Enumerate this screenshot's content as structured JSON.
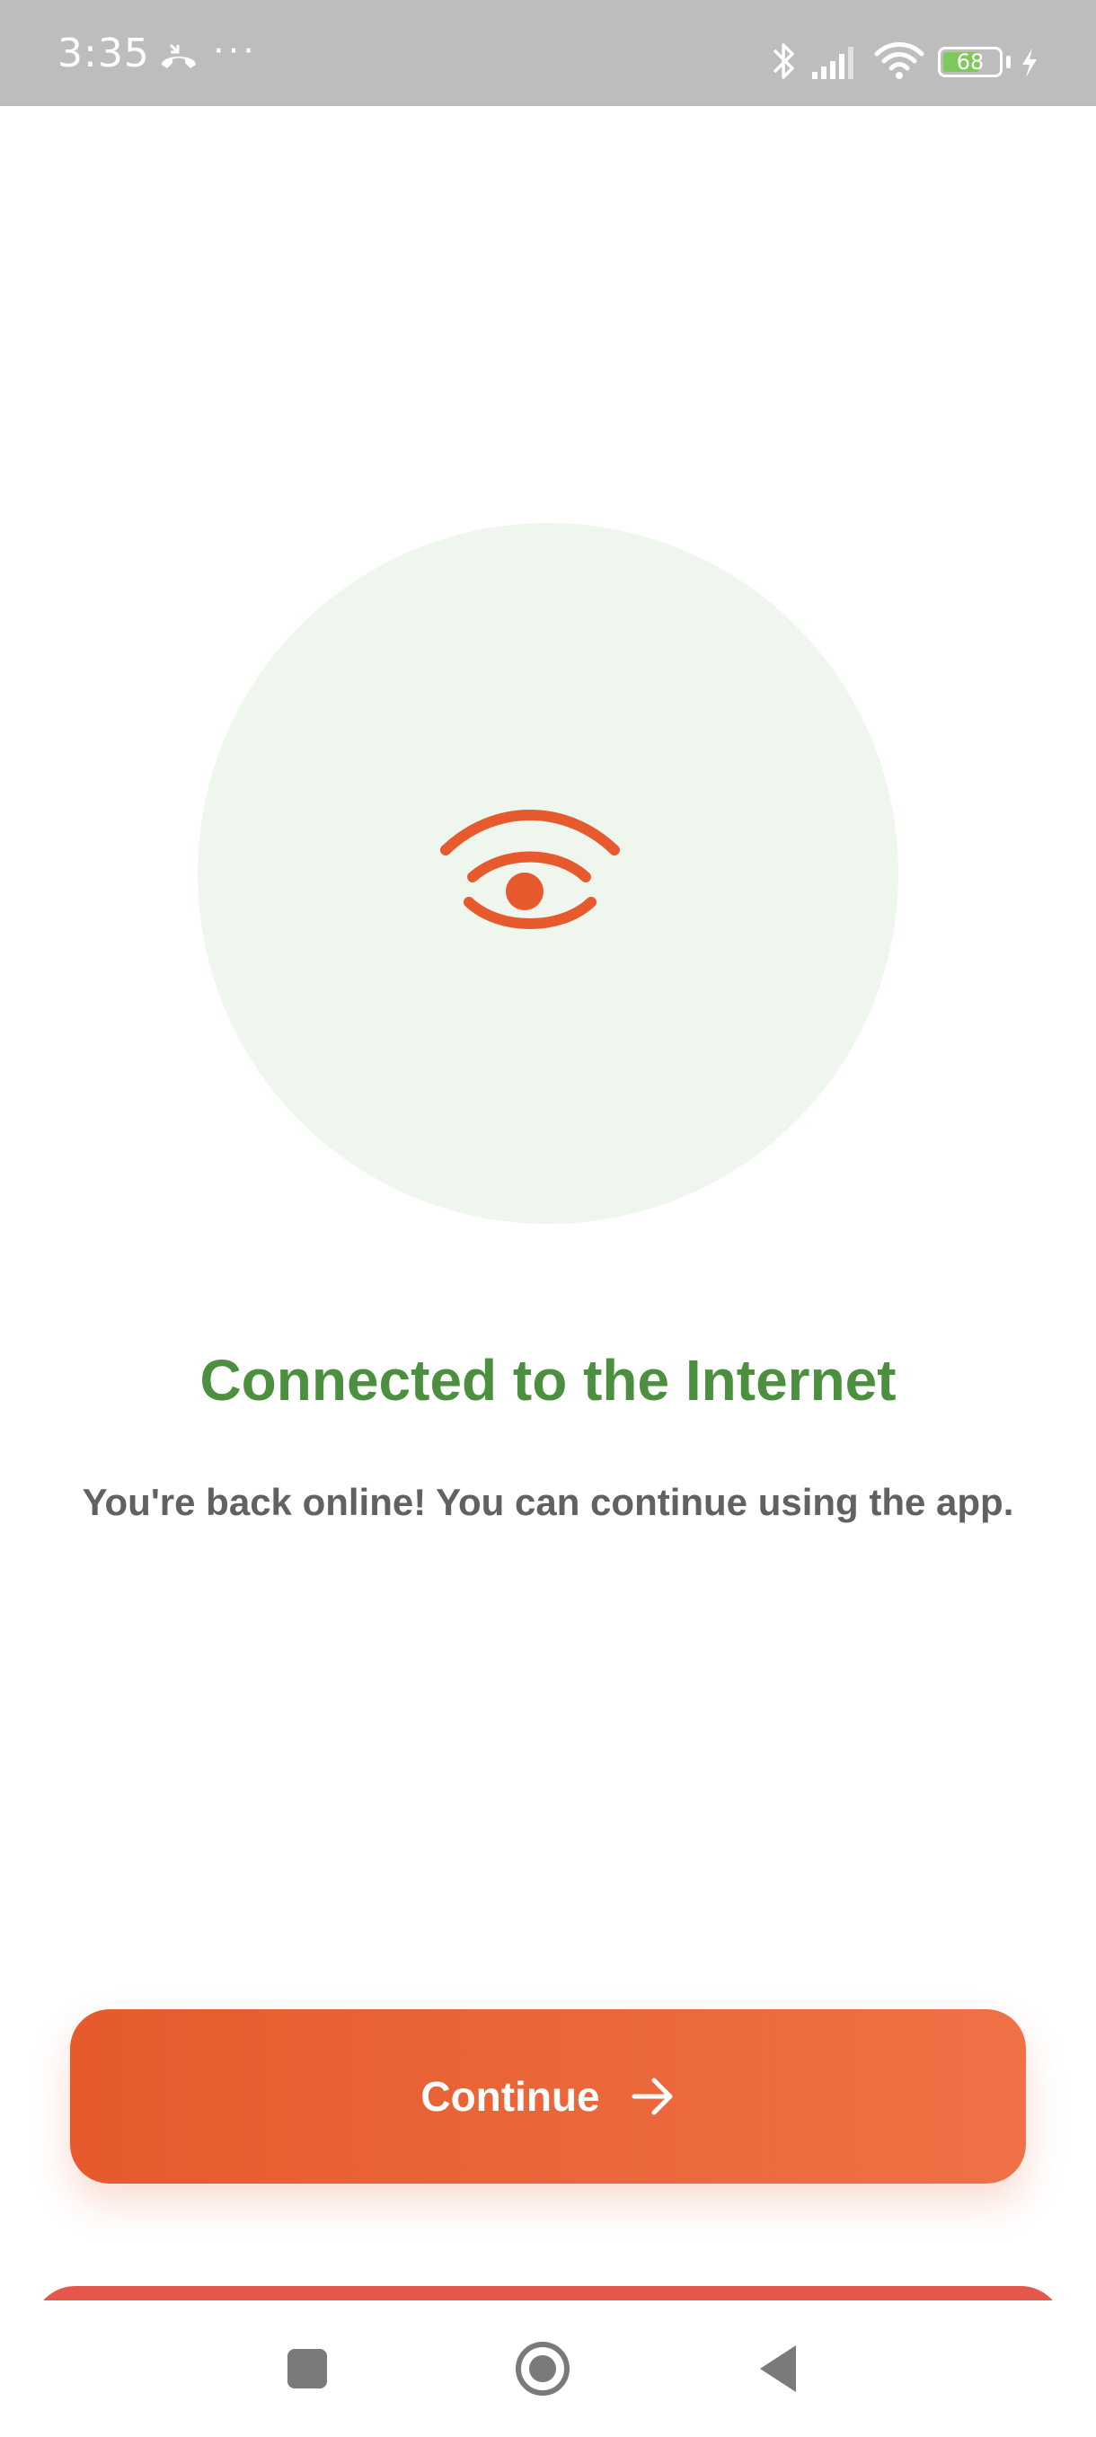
{
  "status_bar": {
    "time": "3:35",
    "more": "···",
    "battery_level": "68",
    "battery_fraction": 0.68,
    "icons": [
      "call-icon",
      "bluetooth-icon",
      "signal-icon",
      "wifi-icon",
      "battery-icon",
      "charging-icon"
    ]
  },
  "hero": {
    "icon": "eye-icon",
    "circle_color": "#eff6ee",
    "icon_color": "#e65a2d"
  },
  "content": {
    "title": "Connected to the Internet",
    "message": "You're back online! You can continue using the app.",
    "title_color": "#4b8f3f",
    "message_color": "#616161"
  },
  "actions": {
    "continue_label": "Continue",
    "continue_icon": "arrow-right-icon",
    "button_colors": [
      "#e65a2d",
      "#ef7145"
    ]
  },
  "nav_bar": {
    "items": [
      "recents-icon",
      "home-icon",
      "back-icon"
    ]
  }
}
